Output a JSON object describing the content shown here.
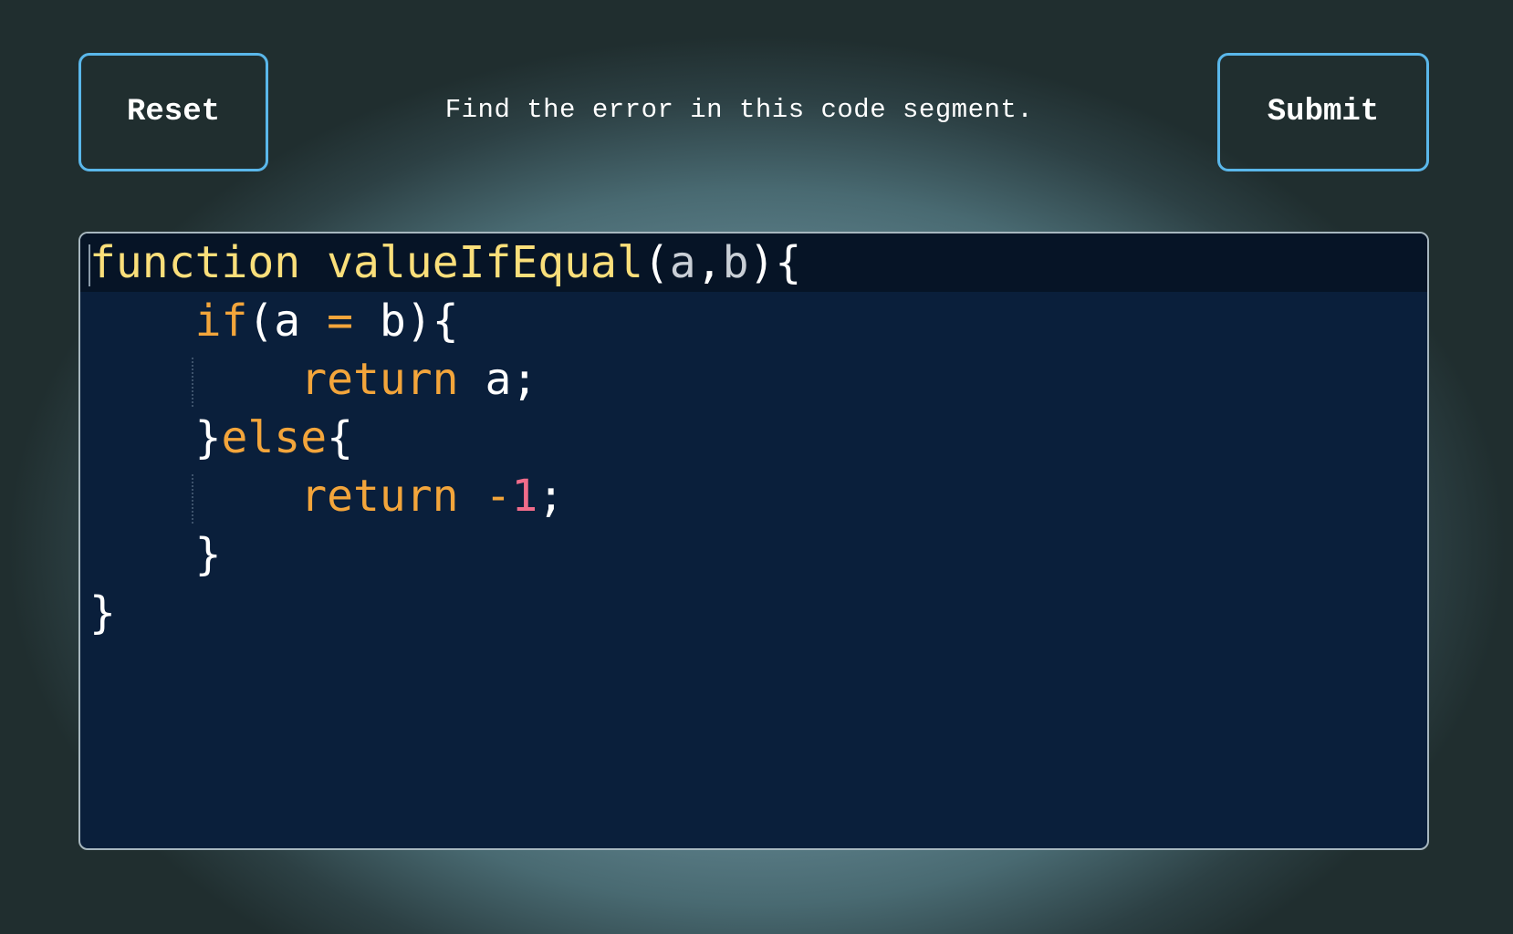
{
  "header": {
    "reset_label": "Reset",
    "prompt": "Find the error in this code segment.",
    "submit_label": "Submit"
  },
  "editor": {
    "lines": [
      [
        {
          "text": "function",
          "kind": "fnkw"
        },
        {
          "text": " ",
          "kind": "plain"
        },
        {
          "text": "valueIfEqual",
          "kind": "fname"
        },
        {
          "text": "(",
          "kind": "plain"
        },
        {
          "text": "a",
          "kind": "param"
        },
        {
          "text": ",",
          "kind": "plain"
        },
        {
          "text": "b",
          "kind": "param"
        },
        {
          "text": "){",
          "kind": "plain"
        }
      ],
      [
        {
          "text": "    ",
          "kind": "plain"
        },
        {
          "text": "if",
          "kind": "kw"
        },
        {
          "text": "(a ",
          "kind": "plain"
        },
        {
          "text": "=",
          "kind": "kw"
        },
        {
          "text": " b){",
          "kind": "plain"
        }
      ],
      [
        {
          "text": "        ",
          "kind": "plain"
        },
        {
          "text": "return",
          "kind": "kw"
        },
        {
          "text": " a;",
          "kind": "plain"
        }
      ],
      [
        {
          "text": "    }",
          "kind": "plain"
        },
        {
          "text": "else",
          "kind": "kw"
        },
        {
          "text": "{",
          "kind": "plain"
        }
      ],
      [
        {
          "text": "        ",
          "kind": "plain"
        },
        {
          "text": "return",
          "kind": "kw"
        },
        {
          "text": " ",
          "kind": "plain"
        },
        {
          "text": "-",
          "kind": "kw"
        },
        {
          "text": "1",
          "kind": "num"
        },
        {
          "text": ";",
          "kind": "plain"
        }
      ],
      [
        {
          "text": "    }",
          "kind": "plain"
        }
      ],
      [
        {
          "text": "}",
          "kind": "plain"
        }
      ]
    ]
  },
  "colors": {
    "accent_border": "#5ab7ea",
    "editor_background": "#0a1f3b",
    "keyword": "#f3a53b",
    "function_name": "#fadf7a",
    "number": "#f06c8a"
  }
}
